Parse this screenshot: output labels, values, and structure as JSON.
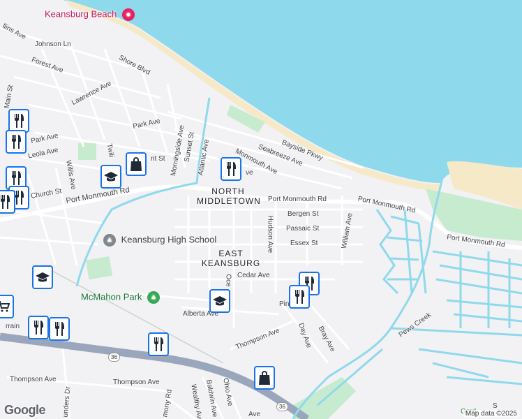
{
  "map": {
    "attribution": "Map data ©2025",
    "logo": "Google"
  },
  "areas": [
    {
      "name": "north_middletown",
      "label": "NORTH MIDDLETOWN"
    },
    {
      "name": "east_keansburg",
      "label": "EAST KEANSBURG"
    }
  ],
  "pois": [
    {
      "name": "keansburg-beach",
      "label": "Keansburg Beach",
      "icon": "camera-icon"
    },
    {
      "name": "keansburg-high-school",
      "label": "Keansburg High School",
      "icon": "school-icon"
    },
    {
      "name": "mcmahon-park",
      "label": "McMahon Park",
      "icon": "tree-icon"
    }
  ],
  "roads": {
    "collins_ave": "llins Ave",
    "johnson_ln": "Johnson Ln",
    "forest_ave": "Forest Ave",
    "shore_blvd": "Shore Blvd",
    "lawrence_ave": "Lawrence Ave",
    "main_st": "Main St",
    "park_ave_1": "Park Ave",
    "park_ave_2": "Park Ave",
    "leola_ave": "Leola Ave",
    "willis_ave": "Willis Ave",
    "church_st": "Church St",
    "twilight": "Twili",
    "morningside_ave": "Morningside Ave",
    "sunset_st": "Sunset St",
    "atlantic_ave": "Atlantic Ave",
    "nt_st": "nt St",
    "bayside_pkwy": "Bayside Pkwy",
    "seabreeze_ave": "Seabreeze Ave",
    "monmouth_ave": "Monmouth Ave",
    "ve_fragment": "ve",
    "port_monmouth_rd_1": "Port Monmouth Rd",
    "port_monmouth_rd_2": "Port Monmouth Rd",
    "port_monmouth_rd_3": "Port Monmouth Rd",
    "port_monmouth_rd_4": "Port Monmouth Rd",
    "bergen_st": "Bergen St",
    "passaic_st": "Passaic St",
    "essex_st": "Essex St",
    "hudson_ave": "Hudson Ave",
    "william_ave": "William Ave",
    "cedar_ave": "Cedar Ave",
    "ocean_ave": "Oce",
    "alberta_ave": "Alberta Ave",
    "pine": "Pin",
    "thompson_ave_1": "Thompson Ave",
    "thompson_ave_2": "Thompson Ave",
    "thompson_ave_3": "Thompson Ave",
    "day_ave": "Day Ave",
    "bray_ave": "Bray Ave",
    "pews_creek": "Pews Creek",
    "baldwin_ave": "Baldwin Ave",
    "ohio_ave": "Ohio Ave",
    "wealthy_ave": "Wealthy Ave",
    "harmony_rd": "mony Rd",
    "saunders_dr": "unders Dr",
    "rrain": "rrain",
    "gord": "Gord",
    "ave_bottom": "Ave",
    "s_fragment": "S"
  },
  "shields": {
    "route_36_a": "36",
    "route_36_b": "36"
  },
  "colors": {
    "water": "#8fd9ed",
    "park": "#c7ebcf",
    "beach": "#f6e9c8",
    "pin_border": "#1a73e8",
    "highway": "#9aa6bb"
  }
}
